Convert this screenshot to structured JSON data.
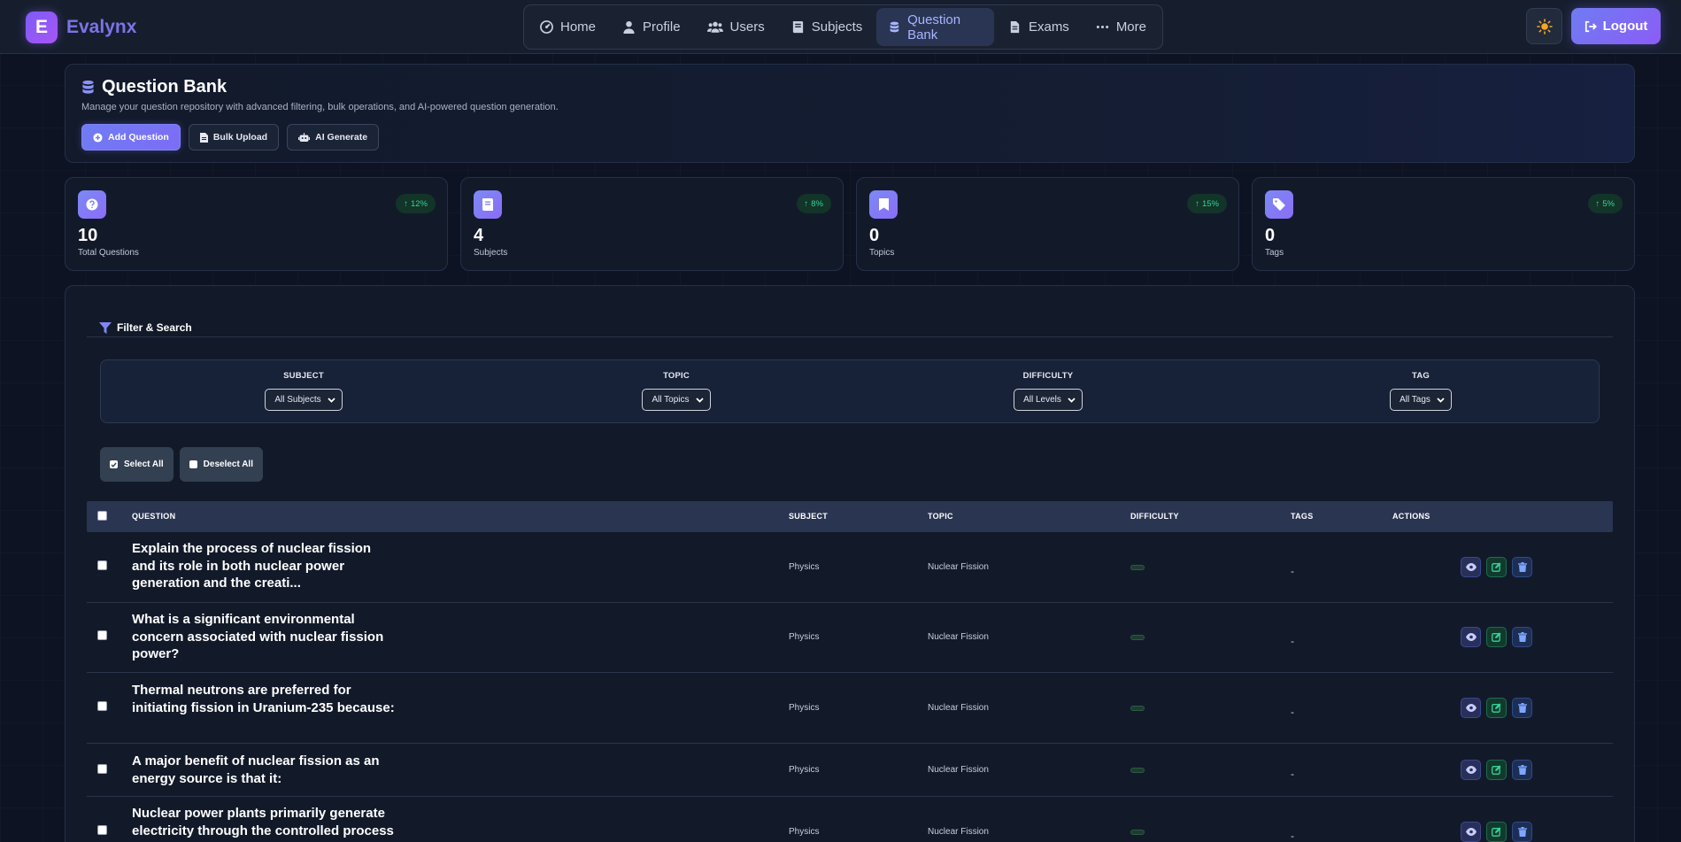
{
  "brand": {
    "logo_letter": "E",
    "name": "Evalynx"
  },
  "nav": {
    "items": [
      {
        "label": "Home",
        "icon": "gauge-icon"
      },
      {
        "label": "Profile",
        "icon": "user-icon"
      },
      {
        "label": "Users",
        "icon": "users-icon"
      },
      {
        "label": "Subjects",
        "icon": "book-icon"
      },
      {
        "label": "Question Bank",
        "icon": "database-icon",
        "active": true
      },
      {
        "label": "Exams",
        "icon": "file-icon"
      },
      {
        "label": "More",
        "icon": "ellipsis-icon"
      }
    ],
    "logout_label": "Logout"
  },
  "header": {
    "title": "Question Bank",
    "subtitle": "Manage your question repository with advanced filtering, bulk operations, and AI-powered question generation.",
    "buttons": {
      "add": "Add Question",
      "bulk": "Bulk Upload",
      "ai": "AI Generate"
    }
  },
  "stats": [
    {
      "value": "10",
      "label": "Total Questions",
      "trend": "12%",
      "icon": "question-circle-icon"
    },
    {
      "value": "4",
      "label": "Subjects",
      "trend": "8%",
      "icon": "book-icon"
    },
    {
      "value": "0",
      "label": "Topics",
      "trend": "15%",
      "icon": "bookmark-icon"
    },
    {
      "value": "0",
      "label": "Tags",
      "trend": "5%",
      "icon": "tag-icon"
    }
  ],
  "filters": {
    "title": "Filter & Search",
    "subject": {
      "label": "SUBJECT",
      "value": "All Subjects"
    },
    "topic": {
      "label": "TOPIC",
      "value": "All Topics"
    },
    "difficulty": {
      "label": "DIFFICULTY",
      "value": "All Levels"
    },
    "tag": {
      "label": "TAG",
      "value": "All Tags"
    }
  },
  "selection": {
    "select_all": "Select All",
    "deselect_all": "Deselect All"
  },
  "table": {
    "headers": {
      "question": "QUESTION",
      "subject": "SUBJECT",
      "topic": "TOPIC",
      "difficulty": "DIFFICULTY",
      "tags": "TAGS",
      "actions": "ACTIONS"
    },
    "rows": [
      {
        "question": "Explain the process of nuclear fission and its role in both nuclear power generation and the creati...",
        "subject": "Physics",
        "topic": "Nuclear Fission",
        "tags": "-"
      },
      {
        "question": "What is a significant environmental concern associated with nuclear fission power?",
        "subject": "Physics",
        "topic": "Nuclear Fission",
        "tags": "-"
      },
      {
        "question": "Thermal neutrons are preferred for initiating fission in Uranium-235 because:",
        "subject": "Physics",
        "topic": "Nuclear Fission",
        "tags": "-"
      },
      {
        "question": "A major benefit of nuclear fission as an energy source is that it:",
        "subject": "Physics",
        "topic": "Nuclear Fission",
        "tags": "-"
      },
      {
        "question": "Nuclear power plants primarily generate electricity through the controlled process",
        "subject": "Physics",
        "topic": "Nuclear Fission",
        "tags": "-"
      }
    ]
  },
  "colors": {
    "accent": "#7c7cf5",
    "trend_up": "#34d399",
    "background": "#0d1322"
  }
}
